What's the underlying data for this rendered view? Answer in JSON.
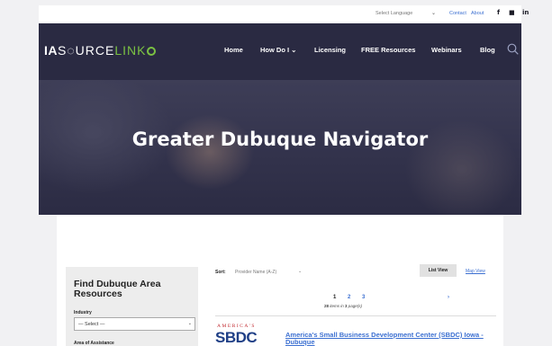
{
  "topbar": {
    "language_label": "Select Language",
    "language_chevron": "⌄",
    "contact_label": "Contact",
    "about_label": "About",
    "social": {
      "facebook": "f",
      "youtube": "■",
      "linkedin": "in"
    }
  },
  "logo": {
    "part1": "IA",
    "part2": "S◌URCE",
    "part3": "LINK"
  },
  "nav": {
    "items": [
      {
        "label": "Home"
      },
      {
        "label": "How Do I ⌄"
      },
      {
        "label": "Licensing"
      },
      {
        "label": "FREE Resources"
      },
      {
        "label": "Webinars"
      },
      {
        "label": "Blog"
      }
    ],
    "search_icon": "search-icon"
  },
  "hero": {
    "title": "Greater Dubuque Navigator"
  },
  "sidebar": {
    "title": "Find Dubuque Area Resources",
    "industry_label": "Industry",
    "industry_value": "— Select —",
    "industry_chevron": "⌄",
    "area_label": "Area of Assistance"
  },
  "results": {
    "sort_label": "Sort:",
    "sort_value": "Provider Name (A-Z)",
    "sort_chevron": "⌄",
    "list_view_label": "List View",
    "map_view_label": "Map View",
    "pages": [
      "1",
      "2",
      "3"
    ],
    "next_label": "›",
    "count_items": "28",
    "count_mid": " items in ",
    "count_pages": "3",
    "count_tail": " page(s)",
    "first": {
      "logo_top": "AMERICA'S",
      "logo_main": "SBDC",
      "title": "America's Small Business Development Center (SBDC) Iowa - Dubuque"
    }
  },
  "colors": {
    "nav_bg": "#2a2a42",
    "accent_green": "#7ac142",
    "link_blue": "#3b6fd1"
  }
}
